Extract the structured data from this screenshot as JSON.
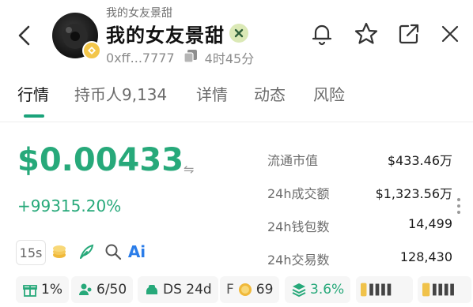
{
  "header": {
    "subtitle": "我的女友景甜",
    "title": "我的女友景甜",
    "address": "0xff...7777",
    "age": "4时45分"
  },
  "tabs": [
    {
      "label": "行情",
      "active": true
    },
    {
      "label": "持币人9,134",
      "active": false
    },
    {
      "label": "详情",
      "active": false
    },
    {
      "label": "动态",
      "active": false
    },
    {
      "label": "风险",
      "active": false
    }
  ],
  "price": {
    "value": "$0.00433",
    "swap_symbol": "⇋",
    "change": "+99315.20%"
  },
  "stats": [
    {
      "label": "流通市值",
      "value": "$433.46万"
    },
    {
      "label": "24h成交额",
      "value": "$1,323.56万"
    },
    {
      "label": "24h钱包数",
      "value": "14,499"
    },
    {
      "label": "24h交易数",
      "value": "128,430"
    }
  ],
  "tools": {
    "interval": "15s",
    "ai_label": "Ai"
  },
  "badges": [
    {
      "icon": "gift-icon",
      "text": "1%"
    },
    {
      "icon": "users-icon",
      "text": "6/50"
    },
    {
      "icon": "ds-icon",
      "text": "DS 24d"
    },
    {
      "icon": "f-coin-icon",
      "prefix": "F",
      "text": "69"
    },
    {
      "icon": "layers-icon",
      "text": "3.6%"
    }
  ],
  "colors": {
    "accent_green": "#27a97a",
    "gold": "#f3c64a",
    "text_primary": "#111111",
    "text_secondary": "#6c6c6c"
  }
}
